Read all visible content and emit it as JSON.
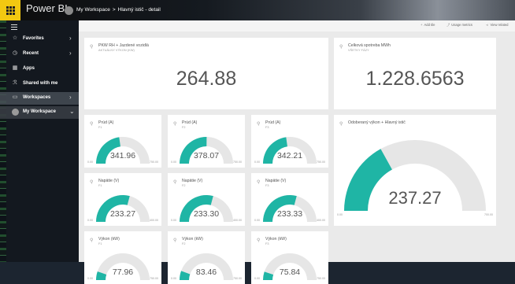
{
  "app": {
    "name": "Power BI"
  },
  "breadcrumb": {
    "workspace": "My Workspace",
    "separator": ">",
    "page": "Hlavný istič - detail"
  },
  "sidebar": {
    "items": [
      {
        "label": "Favorites",
        "icon": "star-icon",
        "has_chevron": true
      },
      {
        "label": "Recent",
        "icon": "clock-icon",
        "has_chevron": true
      },
      {
        "label": "Apps",
        "icon": "apps-icon",
        "has_chevron": false
      },
      {
        "label": "Shared with me",
        "icon": "shared-icon",
        "has_chevron": false
      },
      {
        "label": "Workspaces",
        "icon": "workspaces-icon",
        "has_chevron": true
      },
      {
        "label": "My Workspace",
        "icon": "avatar",
        "has_chevron": true
      }
    ]
  },
  "actions": {
    "add_tile": "Add tile",
    "usage_metrics": "Usage metrics",
    "view_related": "View related"
  },
  "colors": {
    "accent": "#1fb5a5",
    "track": "#e6e6e6",
    "brand_yellow": "#f2c811"
  },
  "cards": [
    {
      "title": "PKW RH + Jazdené vozidlá",
      "subtitle": "AKTUÁLNY VÝKON (KW)",
      "value": "264.88"
    },
    {
      "title": "Celková spotreba MWh",
      "subtitle": "VŠETKY FÁZY",
      "value": "1.228.6563"
    }
  ],
  "gauges": [
    {
      "title": "Prúd (A)",
      "subtitle": "F1",
      "value": "341.96",
      "min": "0.00",
      "max": "750.00",
      "fraction": 0.456
    },
    {
      "title": "Prúd (A)",
      "subtitle": "F2",
      "value": "378.07",
      "min": "0.00",
      "max": "750.00",
      "fraction": 0.504
    },
    {
      "title": "Prúd (A)",
      "subtitle": "F3",
      "value": "342.21",
      "min": "0.00",
      "max": "750.00",
      "fraction": 0.456
    },
    {
      "title": "Napätie (V)",
      "subtitle": "F1",
      "value": "233.27",
      "min": "0.00",
      "max": "400.00",
      "fraction": 0.583
    },
    {
      "title": "Napätie (V)",
      "subtitle": "F2",
      "value": "233.30",
      "min": "0.00",
      "max": "400.00",
      "fraction": 0.583
    },
    {
      "title": "Napätie (V)",
      "subtitle": "F3",
      "value": "233.33",
      "min": "0.00",
      "max": "400.00",
      "fraction": 0.583
    },
    {
      "title": "Výkon (kW)",
      "subtitle": "F1",
      "value": "77.96",
      "min": "0.00",
      "max": "750.00",
      "fraction": 0.104
    },
    {
      "title": "Výkon (kW)",
      "subtitle": "F2",
      "value": "83.46",
      "min": "0.00",
      "max": "750.00",
      "fraction": 0.111
    },
    {
      "title": "Výkon (kW)",
      "subtitle": "F3",
      "value": "75.84",
      "min": "0.00",
      "max": "750.00",
      "fraction": 0.101
    }
  ],
  "big_gauge": {
    "title": "Odoberaný výkon + Hlavný istič",
    "value": "237.27",
    "min": "0.00",
    "max": "700.00",
    "fraction": 0.339
  }
}
